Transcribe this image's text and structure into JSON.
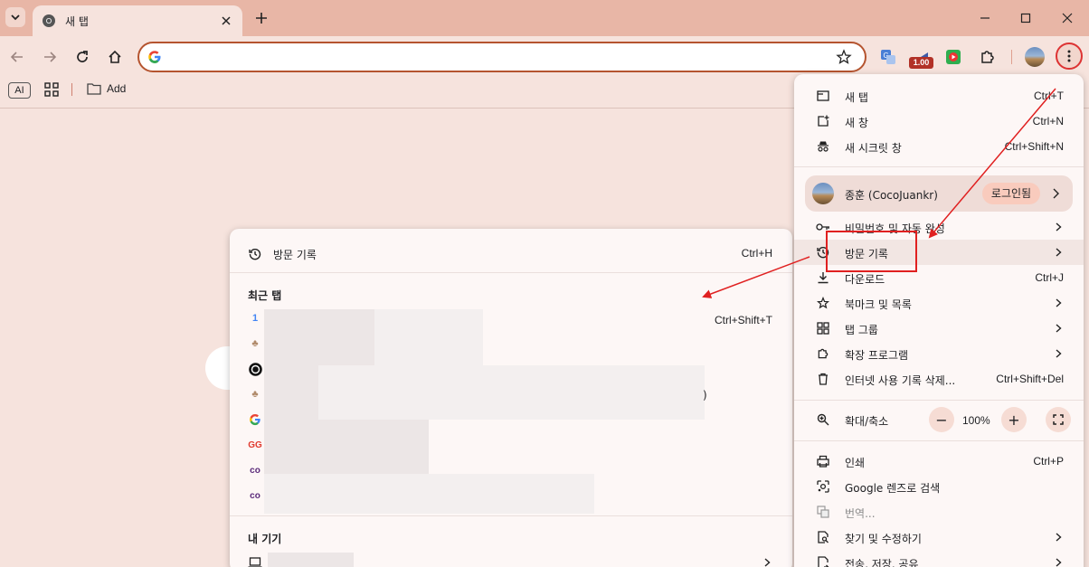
{
  "browser": {
    "tab": {
      "title": "새 탭"
    },
    "omnibox": {
      "value": "",
      "placeholder": ""
    },
    "extensions": {
      "speed_badge": "1.00"
    }
  },
  "bookmarks_bar": {
    "ai_label": "AI",
    "add_label": "Add"
  },
  "history_submenu": {
    "history": {
      "label": "방문 기록",
      "shortcut": "Ctrl+H"
    },
    "recent_tabs": {
      "heading": "최근 탭",
      "reopen_shortcut": "Ctrl+Shift+T",
      "tail_glyph": ")"
    },
    "my_devices": {
      "heading": "내 기기"
    }
  },
  "menu": {
    "new_tab": {
      "label": "새 탭",
      "shortcut": "Ctrl+T"
    },
    "new_window": {
      "label": "새 창",
      "shortcut": "Ctrl+N"
    },
    "incognito": {
      "label": "새 시크릿 창",
      "shortcut": "Ctrl+Shift+N"
    },
    "profile": {
      "name": "종훈 (CocoJuankr)",
      "status": "로그인됨"
    },
    "passwords": {
      "label": "비밀번호 및 자동 완성"
    },
    "history": {
      "label": "방문 기록"
    },
    "downloads": {
      "label": "다운로드",
      "shortcut": "Ctrl+J"
    },
    "bookmarks": {
      "label": "북마크 및 목록"
    },
    "tab_groups": {
      "label": "탭 그룹"
    },
    "extensions": {
      "label": "확장 프로그램"
    },
    "clear_data": {
      "label": "인터넷 사용 기록 삭제...",
      "shortcut": "Ctrl+Shift+Del"
    },
    "zoom": {
      "label": "확대/축소",
      "value": "100%",
      "minus": "−",
      "plus": "+"
    },
    "print": {
      "label": "인쇄",
      "shortcut": "Ctrl+P"
    },
    "lens": {
      "label": "Google 렌즈로 검색"
    },
    "translate": {
      "label": "번역..."
    },
    "find_edit": {
      "label": "찾기 및 수정하기"
    },
    "save_share": {
      "label": "전송, 저장, 공유"
    }
  },
  "colors": {
    "accent": "#b5542f",
    "annotation": "#e02020",
    "tabstrip": "#e8b6a6",
    "toolbar": "#f6e3dd"
  }
}
